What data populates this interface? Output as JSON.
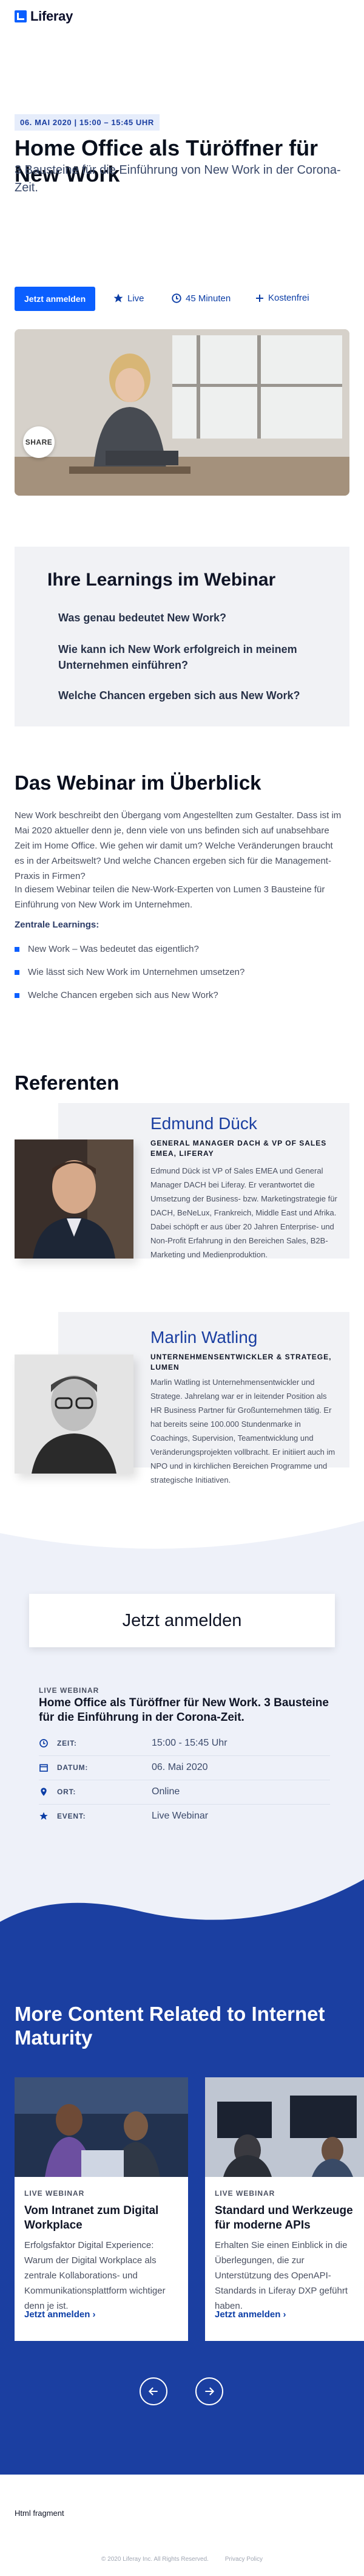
{
  "header": {
    "logo_text": "Liferay"
  },
  "hero": {
    "date_chip": "06. MAI 2020 | 15:00 – 15:45 UHR",
    "title": "Home Office als Türöffner für New Work",
    "subtitle": "3 Bausteine für die Einführung von New Work in der Corona-Zeit.",
    "register_label": "Jetzt anmelden",
    "live_label": "Live",
    "duration_label": "45 Minuten",
    "cost_label": "Kostenfrei",
    "share_label": "SHARE"
  },
  "learnings": {
    "title": "Ihre Learnings im Webinar",
    "items": [
      "Was genau bedeutet New Work?",
      "Wie kann ich New Work erfolgreich in meinem Unternehmen einführen?",
      "Welche Chancen ergeben sich aus New Work?"
    ]
  },
  "overview": {
    "title": "Das Webinar im Überblick",
    "para1": "New Work beschreibt den Übergang vom Angestellten zum Gestalter. Dass ist im Mai 2020 aktueller denn je, denn viele von uns befinden sich auf unabsehbare Zeit im Home Office. Wie gehen wir damit um? Welche Veränderungen braucht es in der Arbeitswelt? Und welche Chancen ergeben sich für die Management-Praxis in Firmen?",
    "para2": "In diesem Webinar teilen die New-Work-Experten von Lumen 3 Bausteine für Einführung von New Work im Unternehmen.",
    "list_title": "Zentrale Learnings:",
    "list": [
      "New Work – Was bedeutet das eigentlich?",
      "Wie lässt sich New Work im Unternehmen umsetzen?",
      "Welche Chancen ergeben sich aus New Work?"
    ]
  },
  "speakers": {
    "title": "Referenten",
    "items": [
      {
        "name": "Edmund Dück",
        "role": "GENERAL MANAGER DACH & VP OF SALES EMEA, LIFERAY",
        "bio": "Edmund Dück ist VP of Sales EMEA und General Manager DACH bei Liferay. Er verantwortet die Umsetzung der Business- bzw. Marketingstrategie für DACH, BeNeLux, Frankreich, Middle East und Afrika. Dabei schöpft er aus über 20 Jahren Enterprise- und Non-Profit Erfahrung in den Bereichen Sales, B2B-Marketing und Medienproduktion."
      },
      {
        "name": "Marlin Watling",
        "role": "UNTERNEHMENSENTWICKLER & STRATEGE, LUMEN",
        "bio": "Marlin Watling ist Unternehmensentwickler und Stratege. Jahrelang war er in leitender Position als HR Business Partner für Großunternehmen tätig. Er hat bereits seine 100.000 Stundenmarke in Coachings, Supervision, Teamentwicklung und Veränderungsprojekten vollbracht. Er initiiert auch im NPO und in kirchlichen Bereichen Programme und strategische Initiativen."
      }
    ]
  },
  "register": {
    "title": "Jetzt anmelden",
    "kicker": "LIVE WEBINAR",
    "event_title": "Home Office als Türöffner für New Work. 3 Bausteine für die Einführung in der Corona-Zeit.",
    "rows": [
      {
        "label": "ZEIT:",
        "value": "15:00 - 15:45 Uhr"
      },
      {
        "label": "DATUM:",
        "value": "06. Mai 2020"
      },
      {
        "label": "ORT:",
        "value": "Online"
      },
      {
        "label": "EVENT:",
        "value": "Live Webinar"
      }
    ]
  },
  "more": {
    "title": "More Content Related to Internet Maturity",
    "cards": [
      {
        "kicker": "LIVE WEBINAR",
        "title": "Vom Intranet zum Digital Workplace",
        "desc": "Erfolgsfaktor Digital Experience: Warum der Digital Workplace als zentrale Kollaborations- und Kommunikationsplattform wichtiger denn je ist.",
        "link": "Jetzt anmelden"
      },
      {
        "kicker": "LIVE WEBINAR",
        "title": "Standard und Werkzeuge für moderne APIs",
        "desc": "Erhalten Sie einen Einblick in die Überlegungen, die zur Unterstützung des OpenAPI-Standards in Liferay DXP geführt haben.",
        "link": "Jetzt anmelden"
      }
    ]
  },
  "footer": {
    "title": "Html fragment",
    "copyright": "© 2020 Liferay Inc. All Rights Reserved.",
    "privacy": "Privacy Policy"
  },
  "colors": {
    "accent": "#0b5fff",
    "dark_blue": "#1b3fa1",
    "panel": "#f1f2f5"
  }
}
